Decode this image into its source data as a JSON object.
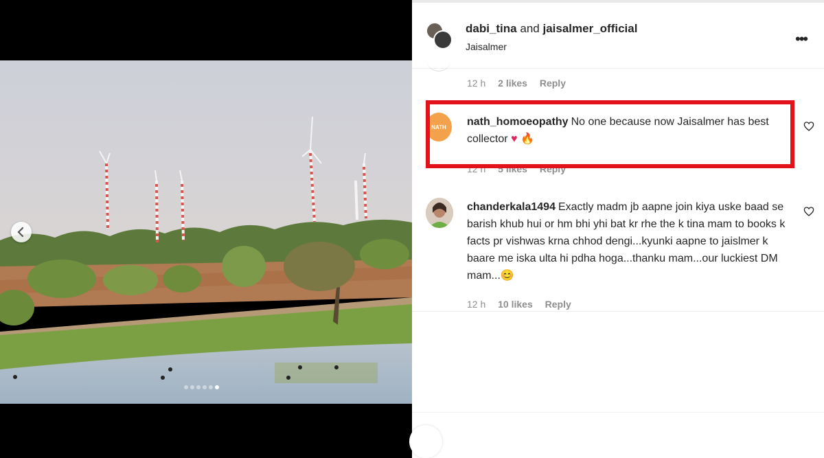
{
  "post": {
    "carousel": {
      "slide_count": 6,
      "active_slide": 6
    }
  },
  "header": {
    "user_a": "dabi_tina",
    "joiner": "and",
    "user_b": "jaisalmer_official",
    "location": "Jaisalmer",
    "more_label": "•••"
  },
  "comments": [
    {
      "time": "12 h",
      "likes": "2 likes",
      "reply": "Reply"
    },
    {
      "username": "nath_homoeopathy",
      "text": "No one because now Jaisalmer has best collector",
      "emoji": "♥ 🔥",
      "avatar_text": "NATH",
      "time": "12 h",
      "likes": "5 likes",
      "reply": "Reply"
    },
    {
      "username": "chanderkala1494",
      "text": "Exactly madm jb aapne join kiya uske baad se barish khub hui or hm bhi yhi bat kr rhe the k tina mam to books k facts pr vishwas krna chhod dengi...kyunki aapne to jaislmer k baare me iska ulta hi pdha hoga...thanku mam...our luckiest DM mam...",
      "emoji": "😊",
      "time": "12 h",
      "likes": "10 likes",
      "reply": "Reply"
    }
  ],
  "colors": {
    "highlight": "#e3111c",
    "text": "#262626",
    "muted": "#8e8e8e",
    "heart_red": "#e0245e",
    "avatar_orange": "#f3a14a"
  },
  "icons": [
    "chevron-left-icon",
    "more-icon",
    "heart-icon",
    "fire-emoji",
    "smile-emoji"
  ]
}
